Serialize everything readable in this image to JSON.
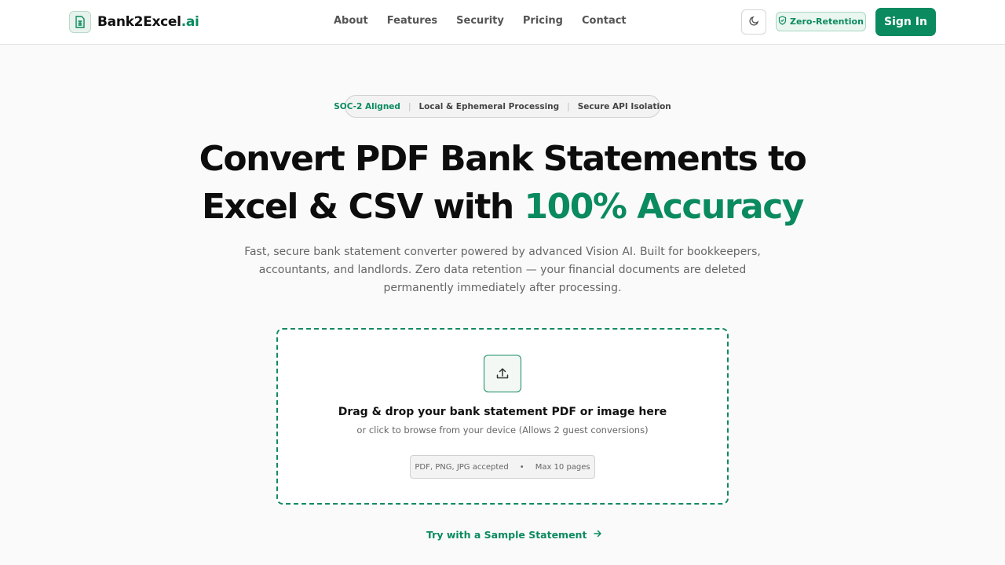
{
  "header": {
    "logo": {
      "name": "Bank2Excel",
      "suffix": ".ai",
      "icon": "document-icon"
    },
    "nav": [
      "About",
      "Features",
      "Security",
      "Pricing",
      "Contact"
    ],
    "theme_toggle_icon": "moon-icon",
    "badge": {
      "label": "Zero-Retention",
      "icon": "shield-icon"
    },
    "sign_in": "Sign In"
  },
  "compliance": [
    "SOC-2 Aligned",
    "Local & Ephemeral Processing",
    "Secure API Isolation"
  ],
  "hero": {
    "line1": "Convert PDF Bank Statements to",
    "line2": "Excel & CSV with ",
    "accent": "100% Accuracy",
    "description": "Fast, secure bank statement converter powered by advanced Vision AI. Built for bookkeepers, accountants, and landlords. Zero data retention — your financial documents are deleted permanently immediately after processing."
  },
  "dropzone": {
    "icon": "upload-icon",
    "title": "Drag & drop your bank statement PDF or image here",
    "subtitle": "or click to browse from your device (Allows 2 guest conversions)",
    "formats": "PDF, PNG, JPG accepted",
    "separator": "•",
    "limit": "Max 10 pages"
  },
  "sample_link": {
    "label": "Try with a Sample Statement",
    "icon": "arrow-right-icon"
  },
  "colors": {
    "accent": "#0a8a5f",
    "background": "#fafafa"
  }
}
